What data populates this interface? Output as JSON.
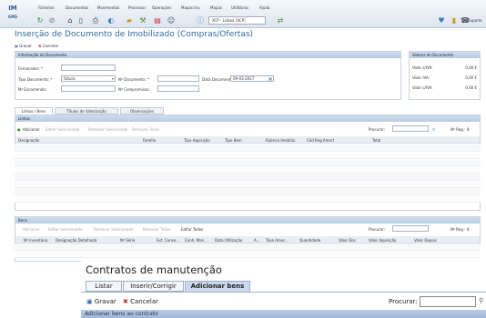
{
  "app": {
    "logo_top": "IM",
    "logo_bottom": "GMS",
    "menu": [
      "Ficheiros",
      "Documentos",
      "Movimentos",
      "Processar",
      "Operações",
      "Mapas Inv.",
      "Mapas",
      "Utilitários",
      "Ajuda"
    ],
    "context_select": "XCP - Lisboa [XCP]",
    "support_label": "Suporte",
    "page_title": "Inserção de Documento de Imobilizado (Compras/Ofertas)",
    "save_label": "Gravar",
    "cancel_label": "Cancelar"
  },
  "doc_info": {
    "header": "Informação do Documento",
    "fornecedor_label": "Fornecedor: *",
    "tipo_label": "Tipo Documento: *",
    "tipo_value": "Fatura",
    "encomenda_label": "Nº Encomenda:",
    "ndoc_label": "Nº Documento: *",
    "ncompromisso_label": "Nº Compromisso:",
    "data_label": "Data Documento:",
    "data_value": "09-03-2017"
  },
  "totals": {
    "header": "Valores do Documento",
    "rows": [
      {
        "label": "Valor s/IVA:",
        "value": "0,00 €"
      },
      {
        "label": "Valor IVA:",
        "value": "0,00 €"
      },
      {
        "label": "Valor c/IVA:",
        "value": "0,00 €"
      }
    ]
  },
  "tabs": [
    "Linhas / Bens",
    "Títulos de Valorização",
    "Observações"
  ],
  "lines": {
    "header": "Linhas",
    "actions": [
      "Adicionar",
      "Editar Selecionado",
      "Remover Selecionado",
      "Remover Todas"
    ],
    "search_label": "Procurar:",
    "per_page_label": "Nº Reg.:",
    "per_page_value": "8",
    "columns": [
      "Designação",
      "Família",
      "Tipo Aquisição",
      "Tipo Bem",
      "Rubrica Imobiliz.",
      "Cód.Reg.Amort",
      "Total"
    ]
  },
  "bens": {
    "header": "Bens",
    "actions": [
      "Adicionar",
      "Editar Selecionado",
      "Remover Selecionado",
      "Remover Todos",
      "Editar Todos"
    ],
    "search_label": "Procurar:",
    "per_page_label": "Nº Reg.:",
    "per_page_value": "8",
    "columns": [
      "Nº Inventário",
      "Designação Detalhada",
      "Nº Série",
      "Ext. Conse...",
      "Conh. Man...",
      "Data Utilização",
      "A...",
      "Taxa Amor...",
      "Quantidade",
      "Valor Doc.",
      "Valor Aquisição",
      "Valor Depois"
    ]
  },
  "popup": {
    "title": "Contratos de manutenção",
    "tabs": [
      "Listar",
      "Inserir/Corrigir",
      "Adicionar bens"
    ],
    "save_label": "Gravar",
    "cancel_label": "Cancelar",
    "search_label": "Procurar:",
    "search_value": "",
    "bottom_label": "Adicionar bens ao contrato"
  }
}
